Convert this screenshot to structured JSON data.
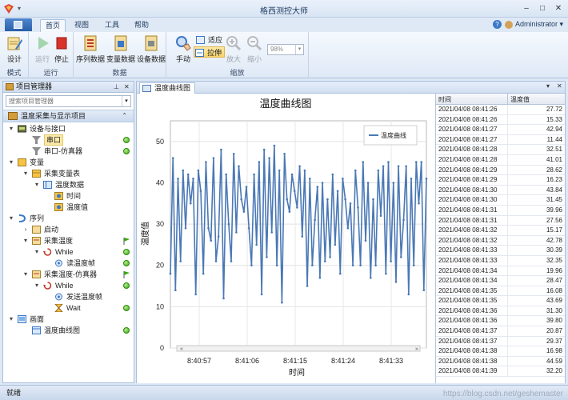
{
  "window": {
    "title": "格西测控大师"
  },
  "ribbon_tabs": [
    "首页",
    "视图",
    "工具",
    "帮助"
  ],
  "user": {
    "name": "Administrator",
    "dropdown": "▾"
  },
  "ribbon": {
    "groups": [
      {
        "label": "模式",
        "buttons": [
          "设计"
        ]
      },
      {
        "label": "运行",
        "buttons": [
          "运行",
          "停止"
        ]
      },
      {
        "label": "数据",
        "buttons": [
          "序列数据",
          "变量数据",
          "设备数据"
        ]
      },
      {
        "label": "缩放",
        "buttons": [
          "手动",
          "适应",
          "拉伸",
          "放大",
          "缩小"
        ]
      }
    ],
    "zoom_value": "98%"
  },
  "left_panel": {
    "title": "项目管理器",
    "search_placeholder": "搜索项目管理器",
    "project_title": "温度采集与显示项目",
    "tree": [
      {
        "label": "设备与接口"
      },
      {
        "label": "串口"
      },
      {
        "label": "串口-仿真器"
      },
      {
        "label": "变量"
      },
      {
        "label": "采集变量表"
      },
      {
        "label": "温度数据"
      },
      {
        "label": "时间"
      },
      {
        "label": "温度值"
      },
      {
        "label": "序列"
      },
      {
        "label": "启动"
      },
      {
        "label": "采集温度"
      },
      {
        "label": "While"
      },
      {
        "label": "读温度帧"
      },
      {
        "label": "采集温度-仿真器"
      },
      {
        "label": "While"
      },
      {
        "label": "发送温度帧"
      },
      {
        "label": "Wait"
      },
      {
        "label": "画面"
      },
      {
        "label": "温度曲线图"
      }
    ]
  },
  "document": {
    "tab_label": "温度曲线图"
  },
  "chart_data": {
    "type": "line",
    "title": "温度曲线图",
    "xlabel": "时间",
    "ylabel": "温度值",
    "ylim": [
      0,
      55
    ],
    "yticks": [
      "0",
      "10",
      "20",
      "30",
      "40",
      "50"
    ],
    "xticks": [
      "8:40:57",
      "8:41:06",
      "8:41:15",
      "8:41:24",
      "8:41:33"
    ],
    "legend_position": "top-right",
    "grid": true,
    "series": [
      {
        "name": "温度曲线",
        "color": "#4a78b5",
        "values": [
          18,
          46,
          14,
          41,
          21,
          43,
          29,
          42,
          35,
          41,
          13,
          43,
          38,
          18,
          45,
          29,
          26,
          46,
          21,
          27,
          48,
          12,
          42,
          30,
          21,
          47,
          28,
          44,
          36,
          33,
          39,
          29,
          20,
          42,
          25,
          45,
          13,
          48,
          22,
          46,
          28,
          49,
          20,
          43,
          11,
          47,
          36,
          33,
          42,
          38,
          34,
          44,
          27,
          43,
          15,
          41,
          20,
          31,
          39,
          17,
          40,
          21,
          36,
          22,
          42,
          25,
          38,
          18,
          41,
          36,
          29,
          35,
          20,
          43,
          34,
          20,
          45,
          26,
          40,
          17,
          36,
          20,
          43,
          32,
          44,
          18,
          45,
          21,
          40,
          16,
          44,
          22,
          31,
          44,
          13,
          41,
          20,
          45,
          35,
          45,
          14,
          41
        ]
      }
    ]
  },
  "table": {
    "headers": [
      "时间",
      "温度值"
    ],
    "rows": [
      [
        "2021/04/08 08:41:26",
        "27.72"
      ],
      [
        "2021/04/08 08:41:26",
        "15.33"
      ],
      [
        "2021/04/08 08:41:27",
        "42.94"
      ],
      [
        "2021/04/08 08:41:27",
        "11.44"
      ],
      [
        "2021/04/08 08:41:28",
        "32.51"
      ],
      [
        "2021/04/08 08:41:28",
        "41.01"
      ],
      [
        "2021/04/08 08:41:29",
        "28.62"
      ],
      [
        "2021/04/08 08:41:29",
        "16.23"
      ],
      [
        "2021/04/08 08:41:30",
        "43.84"
      ],
      [
        "2021/04/08 08:41:30",
        "31.45"
      ],
      [
        "2021/04/08 08:41:31",
        "39.96"
      ],
      [
        "2021/04/08 08:41:31",
        "27.56"
      ],
      [
        "2021/04/08 08:41:32",
        "15.17"
      ],
      [
        "2021/04/08 08:41:32",
        "42.78"
      ],
      [
        "2021/04/08 08:41:33",
        "30.39"
      ],
      [
        "2021/04/08 08:41:33",
        "32.35"
      ],
      [
        "2021/04/08 08:41:34",
        "19.96"
      ],
      [
        "2021/04/08 08:41:34",
        "28.47"
      ],
      [
        "2021/04/08 08:41:35",
        "16.08"
      ],
      [
        "2021/04/08 08:41:35",
        "43.69"
      ],
      [
        "2021/04/08 08:41:36",
        "31.30"
      ],
      [
        "2021/04/08 08:41:36",
        "39.80"
      ],
      [
        "2021/04/08 08:41:37",
        "20.87"
      ],
      [
        "2021/04/08 08:41:37",
        "29.37"
      ],
      [
        "2021/04/08 08:41:38",
        "16.98"
      ],
      [
        "2021/04/08 08:41:38",
        "44.59"
      ],
      [
        "2021/04/08 08:41:39",
        "32.20"
      ]
    ]
  },
  "status": {
    "text": "就绪",
    "watermark": "https://blog.csdn.net/geshemaster"
  },
  "colors": {
    "accent": "#2a5ea8",
    "series": "#4a78b5",
    "status_green": "#3aa316",
    "selection": "#fbe9a8"
  }
}
